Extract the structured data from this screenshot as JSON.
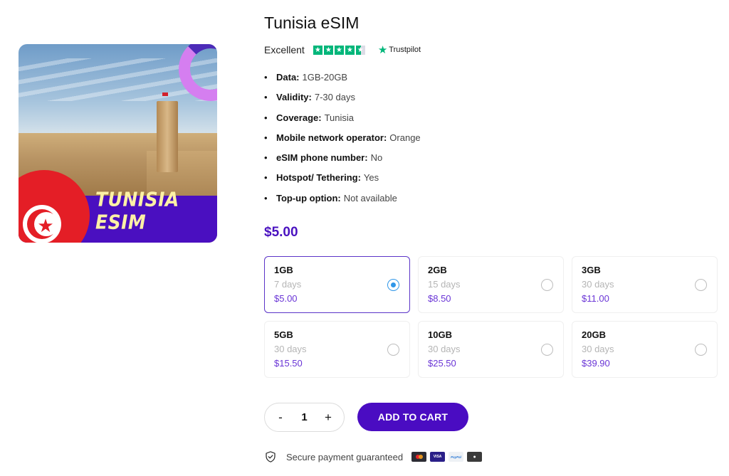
{
  "product": {
    "title": "Tunisia eSIM",
    "image_banner_text": "TUNISIA ESIM",
    "image_alt": "Tunisia eSIM product image with Ribat fortress and Tunisian flag"
  },
  "rating": {
    "label": "Excellent",
    "stars": 4.5,
    "max_stars": 5,
    "provider": "Trustpilot",
    "brand_color": "#00b67a"
  },
  "features": [
    {
      "key": "Data:",
      "value": "1GB-20GB"
    },
    {
      "key": "Validity:",
      "value": "7-30 days"
    },
    {
      "key": "Coverage:",
      "value": "Tunisia"
    },
    {
      "key": "Mobile network operator:",
      "value": "Orange"
    },
    {
      "key": "eSIM phone number:",
      "value": "No"
    },
    {
      "key": "Hotspot/ Tethering:",
      "value": "Yes"
    },
    {
      "key": "Top-up option:",
      "value": "Not available"
    }
  ],
  "price": "$5.00",
  "plans": [
    {
      "size": "1GB",
      "days": "7 days",
      "price": "$5.00",
      "selected": true
    },
    {
      "size": "2GB",
      "days": "15 days",
      "price": "$8.50",
      "selected": false
    },
    {
      "size": "3GB",
      "days": "30 days",
      "price": "$11.00",
      "selected": false
    },
    {
      "size": "5GB",
      "days": "30 days",
      "price": "$15.50",
      "selected": false
    },
    {
      "size": "10GB",
      "days": "30 days",
      "price": "$25.50",
      "selected": false
    },
    {
      "size": "20GB",
      "days": "30 days",
      "price": "$39.90",
      "selected": false
    }
  ],
  "quantity": {
    "minus": "-",
    "value": "1",
    "plus": "+"
  },
  "cart": {
    "add_label": "ADD TO CART"
  },
  "secure": {
    "text": "Secure payment guaranteed",
    "methods": [
      {
        "name": "mastercard",
        "label": ""
      },
      {
        "name": "visa",
        "label": "VISA"
      },
      {
        "name": "paypal",
        "label": "PayPal"
      },
      {
        "name": "apple-pay",
        "label": "●"
      }
    ]
  },
  "colors": {
    "accent": "#4a0cc2",
    "plan_price": "#6a35d6",
    "radio_selected": "#2f96e8"
  }
}
